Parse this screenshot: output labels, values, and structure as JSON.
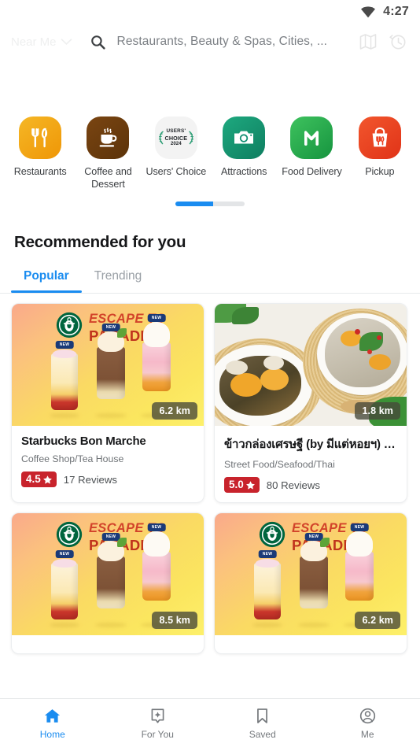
{
  "status_bar": {
    "time": "4:27",
    "wifi_icon": "wifi-icon"
  },
  "header": {
    "location_label": "Near Me",
    "location_chevron_icon": "chevron-down-icon",
    "search_icon": "search-icon",
    "search_placeholder": "Restaurants, Beauty & Spas, Cities, ...",
    "search_value": "",
    "map_icon": "map-icon",
    "history_icon": "history-clock-icon"
  },
  "categories": {
    "items": [
      {
        "label": "Restaurants",
        "icon": "fork-knife-icon",
        "color": "#f2a515"
      },
      {
        "label": "Coffee and Dessert",
        "icon": "coffee-cup-icon",
        "color": "#6b3d10"
      },
      {
        "label": "Users' Choice",
        "icon": "users-choice-badge-icon",
        "color": "#f2f2f2",
        "badge_line1": "USERS'",
        "badge_line2": "CHOICE",
        "badge_year": "2024"
      },
      {
        "label": "Attractions",
        "icon": "camera-icon",
        "color": "#169170"
      },
      {
        "label": "Food Delivery",
        "icon": "m-letter-icon",
        "color": "#23a84b"
      },
      {
        "label": "Pickup",
        "icon": "takeout-bag-icon",
        "color": "#ec4424"
      }
    ],
    "pager": {
      "active_index": 0,
      "count": 2
    }
  },
  "recommended": {
    "title": "Recommended for you",
    "tabs": [
      {
        "label": "Popular",
        "active": true
      },
      {
        "label": "Trending",
        "active": false
      }
    ],
    "cards": [
      {
        "image": "starbucks-escape-to-paradise-promo",
        "promo_line1": "ESCAPE TO",
        "promo_line2": "PARADISE",
        "promo_new_tag": "NEW",
        "distance": "6.2 km",
        "title": "Starbucks Bon Marche",
        "category": "Coffee Shop/Tea House",
        "rating": "4.5",
        "reviews": "17 Reviews"
      },
      {
        "image": "seafood-crab-dishes-photo",
        "distance": "1.8 km",
        "title": "ข้าวกล่องเศรษฐี (by มีแต่หอยฯ) บา...",
        "category": "Street Food/Seafood/Thai",
        "rating": "5.0",
        "reviews": "80 Reviews"
      },
      {
        "image": "starbucks-escape-to-paradise-promo",
        "promo_line1": "ESCAPE TO",
        "promo_line2": "PARADISE",
        "promo_new_tag": "NEW",
        "distance": "8.5 km",
        "title": "",
        "category": "",
        "rating": "",
        "reviews": ""
      },
      {
        "image": "starbucks-escape-to-paradise-promo",
        "promo_line1": "ESCAPE TO",
        "promo_line2": "PARADISE",
        "promo_new_tag": "NEW",
        "distance": "6.2 km",
        "title": "",
        "category": "",
        "rating": "",
        "reviews": ""
      }
    ]
  },
  "bottom_nav": {
    "items": [
      {
        "label": "Home",
        "icon": "home-icon",
        "active": true
      },
      {
        "label": "For You",
        "icon": "foryou-icon",
        "active": false
      },
      {
        "label": "Saved",
        "icon": "bookmark-icon",
        "active": false
      },
      {
        "label": "Me",
        "icon": "account-icon",
        "active": false
      }
    ]
  },
  "colors": {
    "accent": "#1a8cf0",
    "rating_badge": "#c8232c",
    "muted_text": "#75797d"
  }
}
